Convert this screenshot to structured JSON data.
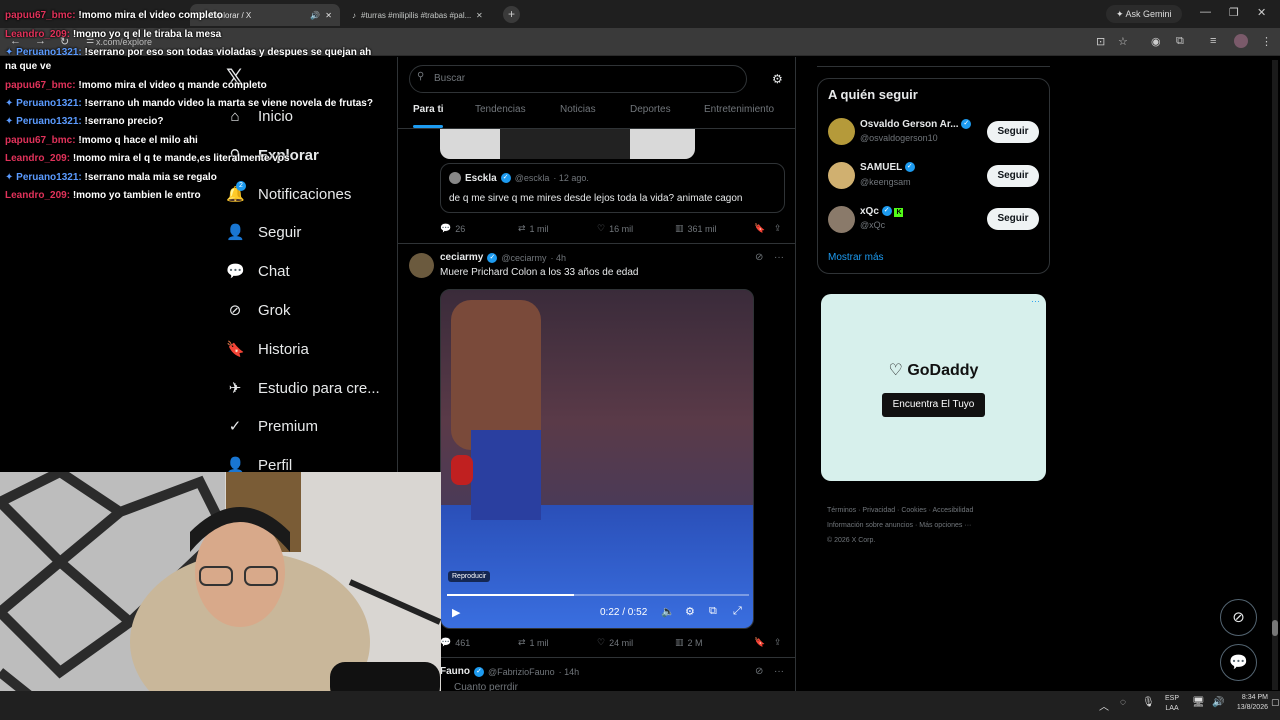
{
  "browser": {
    "tabs": [
      {
        "label": "Explorar / X"
      },
      {
        "label": "#turras #milipilis #trabas #pal..."
      }
    ],
    "url": "x.com/explore",
    "ask_gemini": "Ask Gemini"
  },
  "x": {
    "search_placeholder": "Buscar",
    "nav": [
      "Inicio",
      "Explorar",
      "Notificaciones",
      "Seguir",
      "Chat",
      "Grok",
      "Historia",
      "Estudio para cre...",
      "Premium",
      "Perfil"
    ],
    "notif_badge": "2",
    "tabs": [
      "Para ti",
      "Tendencias",
      "Noticias",
      "Deportes",
      "Entretenimiento"
    ],
    "quote": {
      "name": "Esckla",
      "handle": "@esckla",
      "time": "· 12 ago.",
      "text": "de q me sirve q me mires desde lejos toda la vida? animate cagon"
    },
    "tweet1_actions": {
      "replies": "26",
      "retweets": "1 mil",
      "likes": "16 mil",
      "views": "361 mil"
    },
    "tweet2": {
      "name": "ceciarmy",
      "handle": "@ceciarmy",
      "time": "· 4h",
      "text": "Muere Prichard Colon a los 33 años de edad",
      "video_tooltip": "Reproducir",
      "video_time": "0:22 / 0:52",
      "video_progress": 0.42,
      "replies": "461",
      "retweets": "1 mil",
      "likes": "24 mil",
      "views": "2 M"
    },
    "tweet3": {
      "name": "Fauno",
      "handle": "@FabrizioFauno",
      "time": "· 14h",
      "text": "Cuanto perrdir"
    },
    "who_to_follow": {
      "title": "A quién seguir",
      "users": [
        {
          "name": "Osvaldo Gerson Ar...",
          "handle": "@osvaldogerson10"
        },
        {
          "name": "SAMUEL",
          "handle": "@keengsam"
        },
        {
          "name": "xQc",
          "handle": "@xQc"
        }
      ],
      "follow_label": "Seguir",
      "show_more": "Mostrar más"
    },
    "ad": {
      "brand": "GoDaddy",
      "cta": "Encuentra El Tuyo"
    },
    "footer": [
      "Términos",
      "Privacidad",
      "Cookies",
      "Accesibilidad",
      "Información sobre anuncios",
      "Más opciones ···",
      "© 2026 X Corp."
    ]
  },
  "chat": [
    {
      "user": "papuu67_bmc",
      "msg": "!momo mira el video completo"
    },
    {
      "user": "Leandro_209",
      "msg": "!momo yo q el le tiraba la mesa"
    },
    {
      "user": "Peruano1321",
      "msg": "!serrano por eso son todas violadas y despues se quejan ah"
    },
    {
      "user": "",
      "msg": "na que ve"
    },
    {
      "user": "papuu67_bmc",
      "msg": "!momo mira el video q mande completo"
    },
    {
      "user": "Peruano1321",
      "msg": "!serrano uh mando video la marta se viene novela de frutas?"
    },
    {
      "user": "Peruano1321",
      "msg": "!serrano precio?"
    },
    {
      "user": "papuu67_bmc",
      "msg": "!momo q hace el milo ahi"
    },
    {
      "user": "Leandro_209",
      "msg": "!momo mira el q te mande,es literalmente vos"
    },
    {
      "user": "Peruano1321",
      "msg": "!serrano mala mia se regalo"
    },
    {
      "user": "Leandro_209",
      "msg": "!momo yo tambien le entro"
    }
  ],
  "taskbar": {
    "lang": "ESP",
    "lang2": "LAA",
    "time": "8:34 PM",
    "date": "13/8/2026"
  },
  "colors": {
    "accent": "#1d9bf0",
    "bg": "#000000",
    "chat_red": "#e0325a",
    "chat_blue": "#5b9bff"
  }
}
